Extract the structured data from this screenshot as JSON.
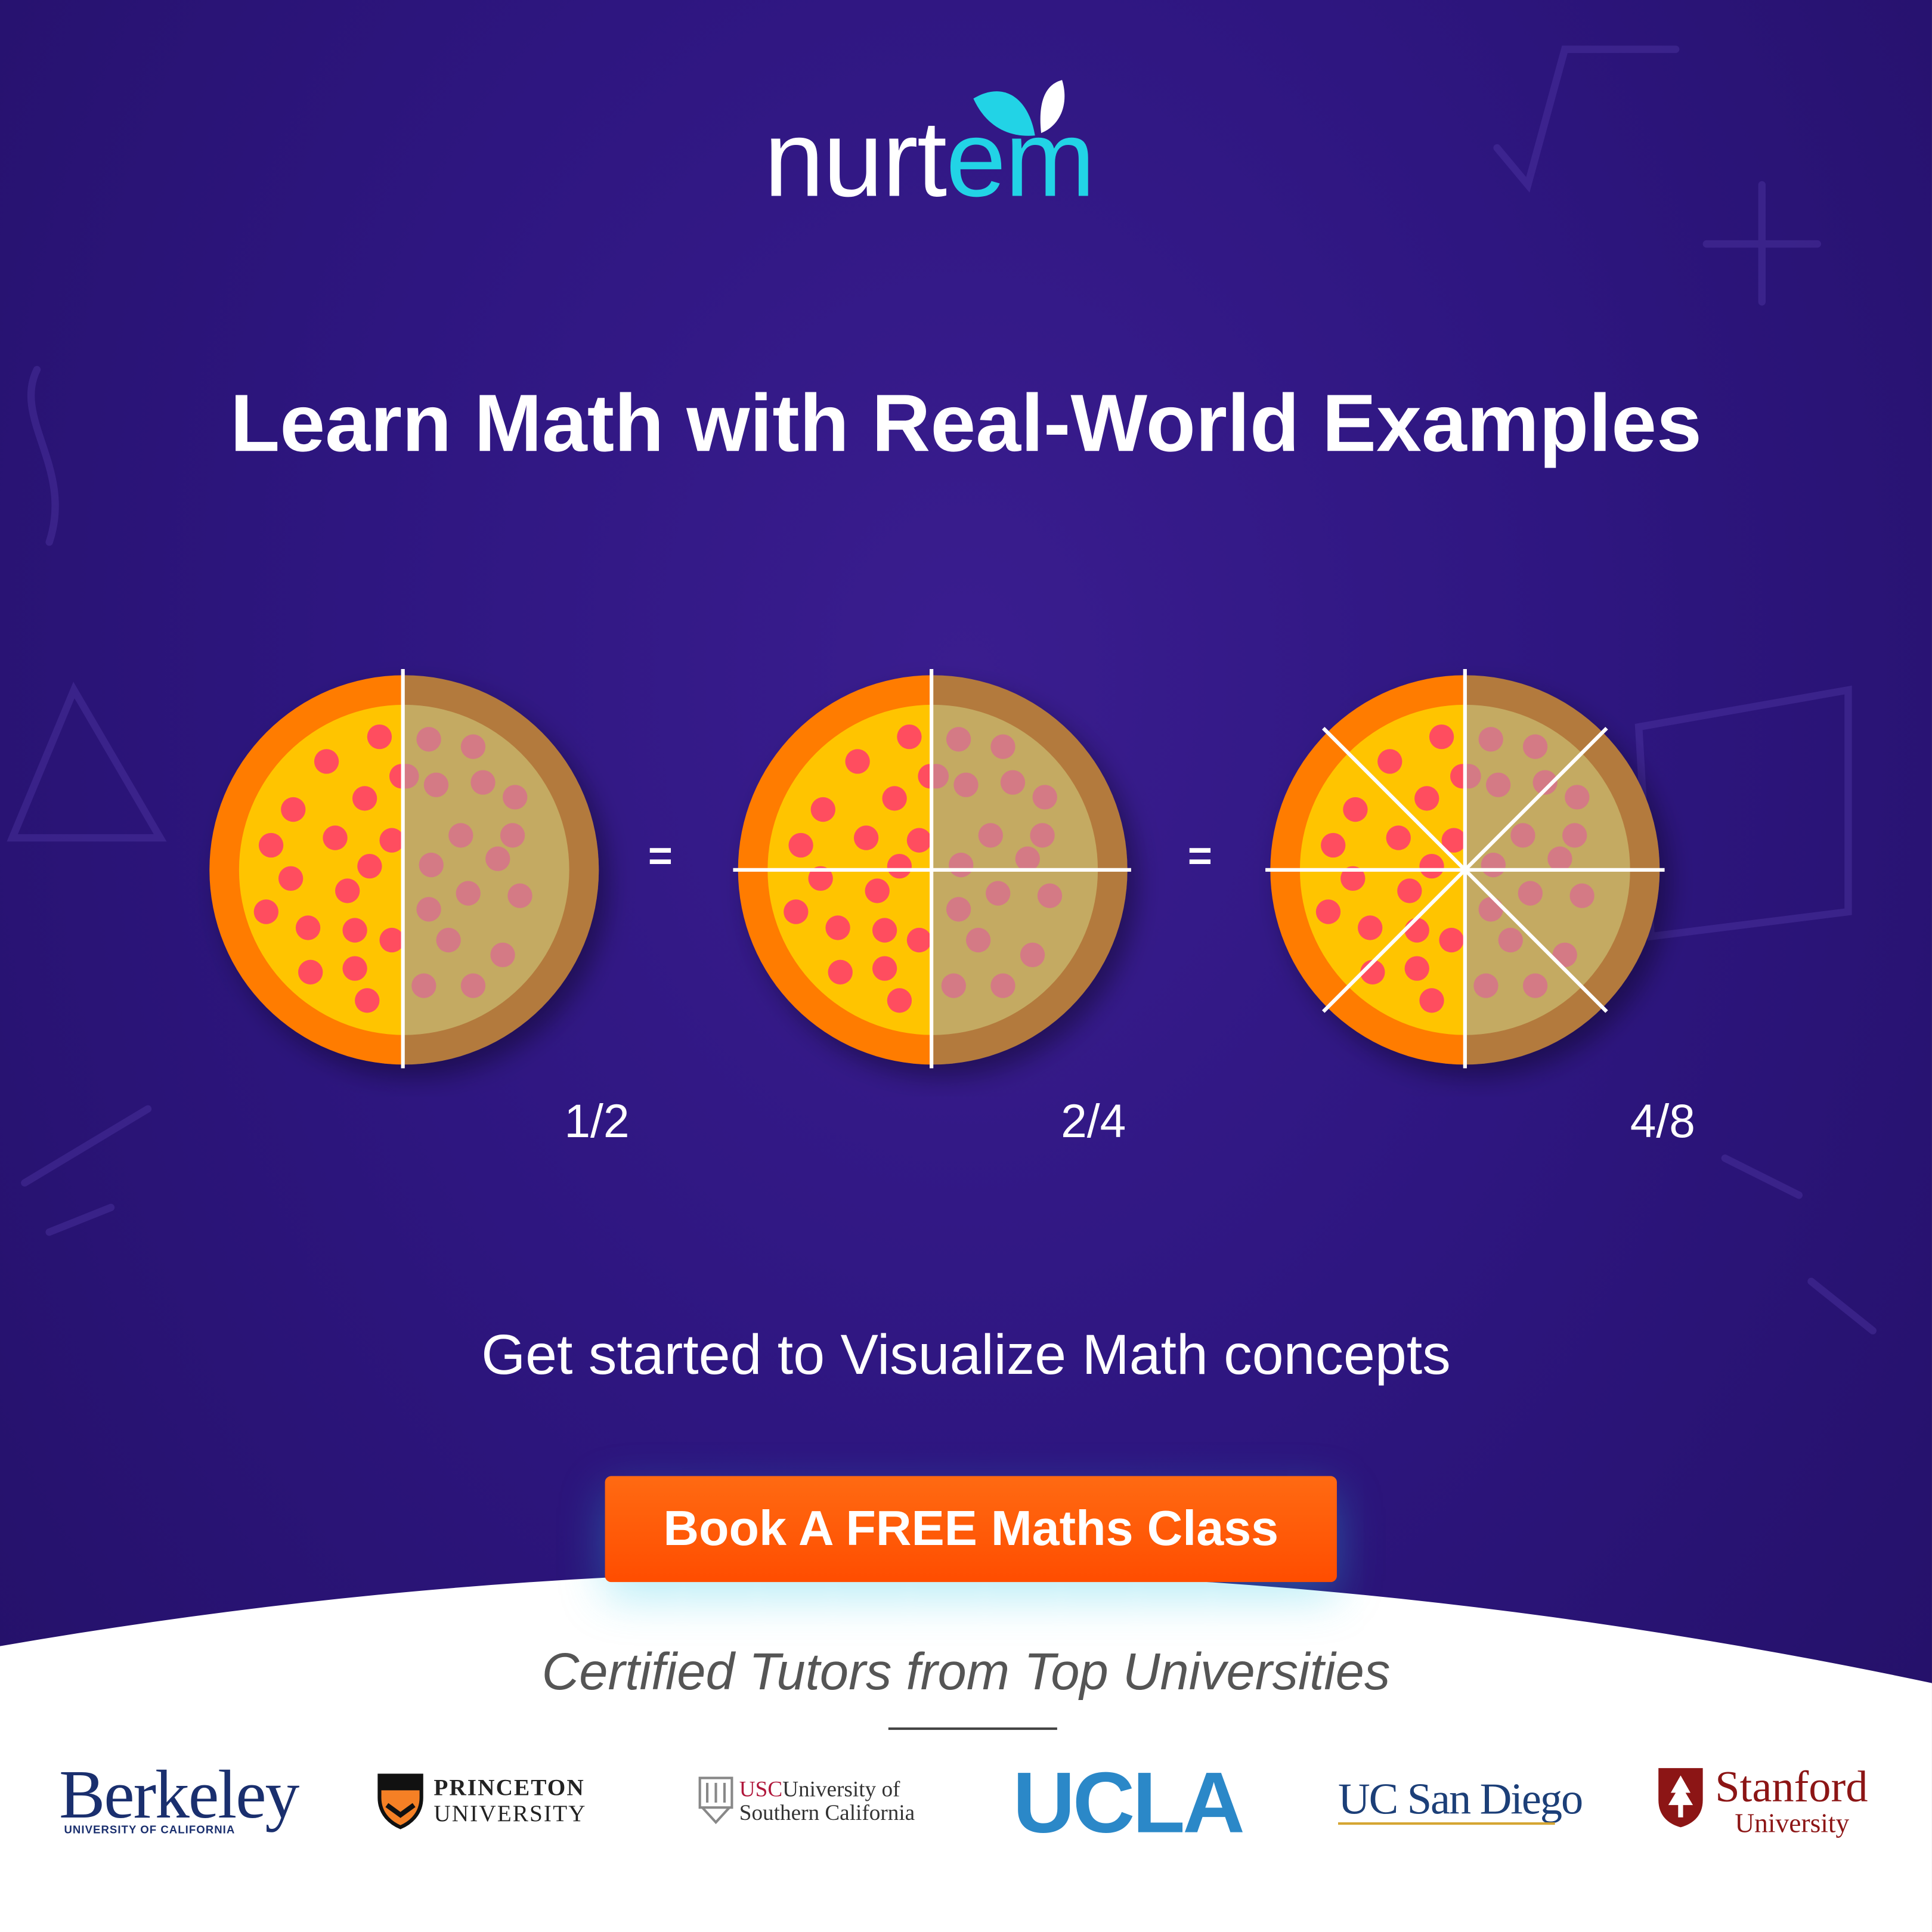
{
  "brand": {
    "name_part1": "nurt",
    "name_part2": "em"
  },
  "headline": "Learn Math with Real-World Examples",
  "illustration": {
    "equals": [
      "=",
      "="
    ],
    "fractions": [
      "1/2",
      "2/4",
      "4/8"
    ]
  },
  "subheadline": "Get started to Visualize Math concepts",
  "cta_label": "Book A FREE Maths Class",
  "certified_text": "Certified Tutors from Top Universities",
  "universities": {
    "berkeley": {
      "name": "Berkeley",
      "sub": "UNIVERSITY OF CALIFORNIA"
    },
    "princeton": {
      "line1": "PRINCETON",
      "line2": "UNIVERSITY"
    },
    "usc": {
      "abbr": "USC",
      "line1": "University of",
      "line2": "Southern California"
    },
    "ucla": {
      "name": "UCLA"
    },
    "ucsd": {
      "name": "UC San Diego"
    },
    "stanford": {
      "line1": "Stanford",
      "line2": "University"
    }
  },
  "colors": {
    "background": "#2e1680",
    "accent_cyan": "#22d3e6",
    "cta_orange": "#ff5a0a",
    "pizza_crust": "#ff7b00",
    "pizza_cheese": "#ffc400",
    "pepperoni": "#ff4d5e"
  }
}
